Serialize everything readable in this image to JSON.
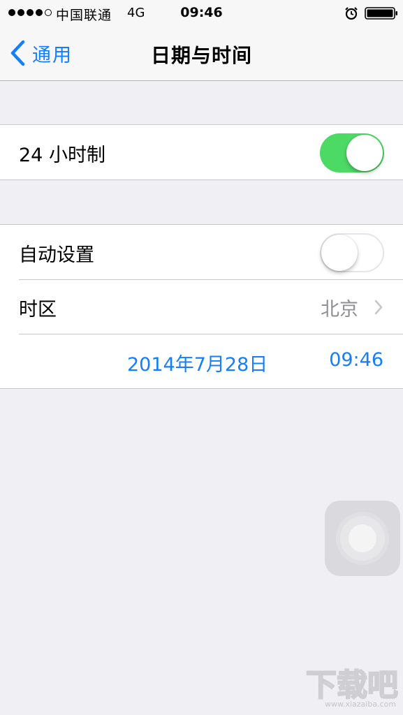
{
  "status_bar": {
    "signal_bars": 4,
    "carrier": "中国联通",
    "network": "4G",
    "time": "09:46",
    "alarm_icon": "alarm-clock-icon",
    "battery_icon": "battery-icon"
  },
  "nav": {
    "back_label": "通用",
    "back_icon": "chevron-left-icon",
    "title": "日期与时间"
  },
  "settings": {
    "hour24": {
      "label": "24 小时制",
      "on": true
    },
    "auto_set": {
      "label": "自动设置",
      "on": false
    },
    "timezone": {
      "label": "时区",
      "value": "北京",
      "icon": "chevron-right-icon"
    },
    "datetime": {
      "date": "2014年7月28日",
      "time": "09:46"
    }
  },
  "overlay": {
    "assistive_touch_icon": "assistive-touch-icon"
  },
  "watermark": {
    "logo_text": "下载吧",
    "url": "www.xiazaiba.com"
  },
  "colors": {
    "accent": "#157efb",
    "toggle_on": "#4cd964",
    "secondary_text": "#8e8e93",
    "background": "#efeff4"
  }
}
